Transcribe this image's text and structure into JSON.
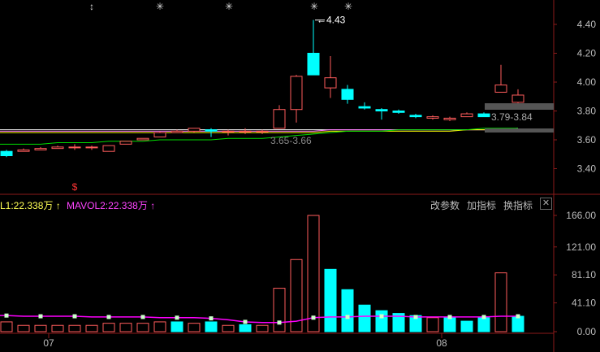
{
  "legend": {
    "mavol1_label": "L1:22.338万",
    "mavol2_label": "MAVOL2:22.338万",
    "arrow": "↑"
  },
  "toolbar": {
    "edit_params": "改参数",
    "add_indicator": "加指标",
    "switch_indicator": "换指标",
    "close": "✕"
  },
  "colors": {
    "up": "#ff5c5c",
    "down": "#00ffff",
    "ma_white": "#ffffff",
    "ma_yellow": "#ffff00",
    "ma_pink": "#ff77ff",
    "ma_green": "#00dd00",
    "mavol_line": "#ff00ff",
    "axis": "#8b1a1a"
  },
  "icons": {
    "event_marker": "asterisk-icon",
    "split_marker": "double-arrow-icon",
    "dividend_marker": "dollar-icon"
  },
  "chart_data": [
    {
      "type": "candlestick",
      "ylim": [
        3.25,
        4.55
      ],
      "yticks": [
        "4.40",
        "4.20",
        "4.00",
        "3.80",
        "3.60",
        "3.40"
      ],
      "max_label": "4.43",
      "range_labels": [
        "3.65-3.66",
        "3.79-3.84"
      ],
      "xticks": [
        "07",
        "08"
      ],
      "markers": [
        "↕",
        "✳",
        "✳",
        "✳",
        "✳",
        "$"
      ],
      "candles": [
        {
          "o": 3.52,
          "c": 3.49,
          "h": 3.53,
          "l": 3.48
        },
        {
          "o": 3.52,
          "c": 3.53,
          "h": 3.54,
          "l": 3.52
        },
        {
          "o": 3.53,
          "c": 3.54,
          "h": 3.55,
          "l": 3.53
        },
        {
          "o": 3.54,
          "c": 3.55,
          "h": 3.56,
          "l": 3.54
        },
        {
          "o": 3.55,
          "c": 3.55,
          "h": 3.57,
          "l": 3.53
        },
        {
          "o": 3.55,
          "c": 3.55,
          "h": 3.56,
          "l": 3.53
        },
        {
          "o": 3.52,
          "c": 3.56,
          "h": 3.56,
          "l": 3.52
        },
        {
          "o": 3.57,
          "c": 3.59,
          "h": 3.59,
          "l": 3.57
        },
        {
          "o": 3.6,
          "c": 3.61,
          "h": 3.61,
          "l": 3.6
        },
        {
          "o": 3.62,
          "c": 3.65,
          "h": 3.66,
          "l": 3.62
        },
        {
          "o": 3.65,
          "c": 3.66,
          "h": 3.67,
          "l": 3.65
        },
        {
          "o": 3.66,
          "c": 3.68,
          "h": 3.68,
          "l": 3.65
        },
        {
          "o": 3.67,
          "c": 3.66,
          "h": 3.68,
          "l": 3.62
        },
        {
          "o": 3.66,
          "c": 3.66,
          "h": 3.67,
          "l": 3.63
        },
        {
          "o": 3.66,
          "c": 3.66,
          "h": 3.68,
          "l": 3.64
        },
        {
          "o": 3.66,
          "c": 3.66,
          "h": 3.67,
          "l": 3.64
        },
        {
          "o": 3.68,
          "c": 3.81,
          "h": 3.84,
          "l": 3.68
        },
        {
          "o": 3.81,
          "c": 4.04,
          "h": 4.05,
          "l": 3.72
        },
        {
          "o": 4.2,
          "c": 4.05,
          "h": 4.43,
          "l": 4.05
        },
        {
          "o": 3.96,
          "c": 4.03,
          "h": 4.18,
          "l": 3.89
        },
        {
          "o": 3.95,
          "c": 3.88,
          "h": 3.98,
          "l": 3.85
        },
        {
          "o": 3.83,
          "c": 3.82,
          "h": 3.86,
          "l": 3.81
        },
        {
          "o": 3.81,
          "c": 3.8,
          "h": 3.82,
          "l": 3.74
        },
        {
          "o": 3.8,
          "c": 3.79,
          "h": 3.81,
          "l": 3.78
        },
        {
          "o": 3.77,
          "c": 3.76,
          "h": 3.78,
          "l": 3.75
        },
        {
          "o": 3.75,
          "c": 3.76,
          "h": 3.77,
          "l": 3.74
        },
        {
          "o": 3.74,
          "c": 3.75,
          "h": 3.76,
          "l": 3.73
        },
        {
          "o": 3.76,
          "c": 3.78,
          "h": 3.79,
          "l": 3.76
        },
        {
          "o": 3.78,
          "c": 3.76,
          "h": 3.79,
          "l": 3.76
        },
        {
          "o": 3.93,
          "c": 3.98,
          "h": 4.12,
          "l": 3.93
        },
        {
          "o": 3.86,
          "c": 3.91,
          "h": 3.95,
          "l": 3.84
        }
      ],
      "series": [
        {
          "values": [
            3.67,
            3.67,
            3.67,
            3.67,
            3.67,
            3.67,
            3.67,
            3.67,
            3.67,
            3.67,
            3.67,
            3.67,
            3.67,
            3.67,
            3.67,
            3.67,
            3.67,
            3.67,
            3.67,
            3.67,
            3.67,
            3.67,
            3.67,
            3.67,
            3.67,
            3.67,
            3.67,
            3.67,
            3.67,
            3.67,
            3.68
          ]
        },
        {
          "values": [
            3.66,
            3.66,
            3.66,
            3.66,
            3.66,
            3.66,
            3.66,
            3.66,
            3.66,
            3.66,
            3.66,
            3.66,
            3.66,
            3.66,
            3.66,
            3.66,
            3.66,
            3.66,
            3.66,
            3.67,
            3.67,
            3.67,
            3.67,
            3.67,
            3.67,
            3.67,
            3.67,
            3.67,
            3.67,
            3.67,
            3.68
          ]
        },
        {
          "values": [
            3.65,
            3.65,
            3.65,
            3.65,
            3.65,
            3.65,
            3.65,
            3.65,
            3.65,
            3.65,
            3.65,
            3.65,
            3.65,
            3.65,
            3.65,
            3.65,
            3.65,
            3.65,
            3.65,
            3.66,
            3.66,
            3.66,
            3.66,
            3.66,
            3.66,
            3.66,
            3.66,
            3.67,
            3.67,
            3.67,
            3.67
          ]
        },
        {
          "values": [
            3.57,
            3.57,
            3.57,
            3.58,
            3.58,
            3.58,
            3.59,
            3.59,
            3.59,
            3.6,
            3.6,
            3.6,
            3.6,
            3.61,
            3.61,
            3.61,
            3.62,
            3.63,
            3.64,
            3.65,
            3.66,
            3.66,
            3.66,
            3.67,
            3.67,
            3.67,
            3.67,
            3.67,
            3.68,
            3.68,
            3.68
          ]
        }
      ]
    },
    {
      "type": "bar",
      "ylim": [
        0,
        180
      ],
      "yticks": [
        "166.00",
        "121.00",
        "81.10",
        "41.10",
        "0.00"
      ],
      "values": [
        14,
        9,
        9,
        9,
        9,
        9,
        12,
        12,
        12,
        14,
        14,
        12,
        14,
        9,
        10,
        9,
        62,
        103,
        166,
        89,
        60,
        38,
        30,
        26,
        23,
        20,
        20,
        15,
        20,
        84,
        22
      ],
      "down": [
        false,
        false,
        false,
        false,
        false,
        false,
        false,
        false,
        false,
        false,
        true,
        false,
        true,
        false,
        true,
        false,
        false,
        false,
        false,
        true,
        true,
        true,
        true,
        true,
        true,
        false,
        true,
        true,
        true,
        false,
        true
      ],
      "mavol": [
        23,
        22,
        22,
        22,
        22,
        21,
        21,
        21,
        21,
        20,
        20,
        20,
        19,
        17,
        14,
        13,
        13,
        15,
        20,
        21,
        21,
        22,
        22,
        22,
        21,
        21,
        21,
        21,
        21,
        22,
        22
      ]
    }
  ]
}
